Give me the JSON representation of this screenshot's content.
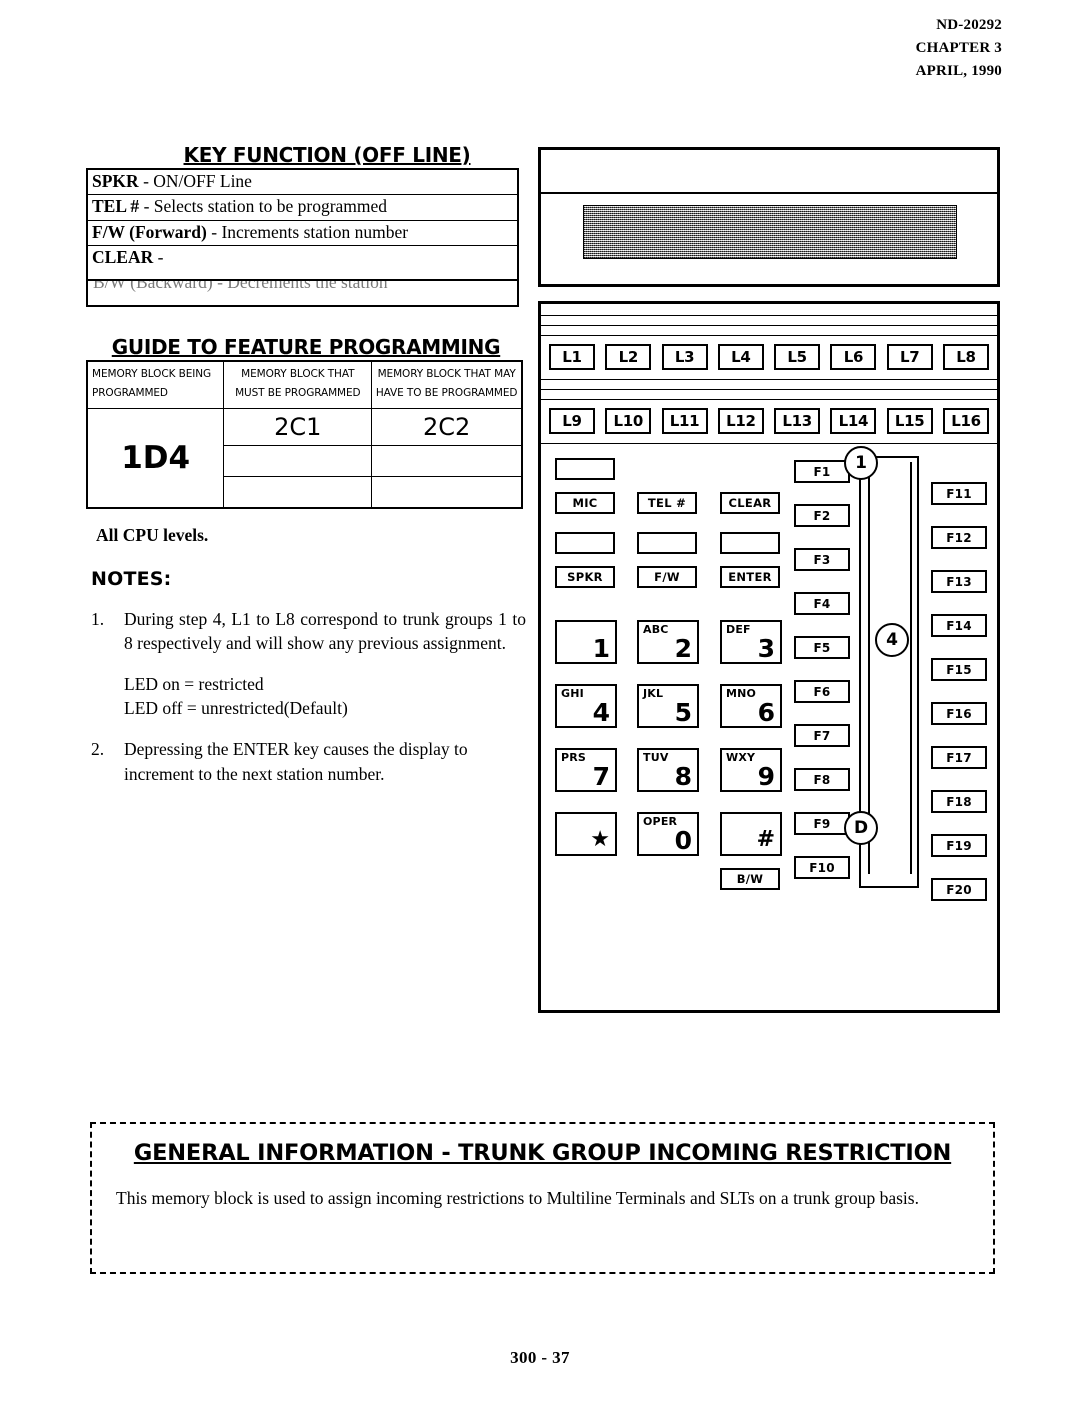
{
  "header": {
    "doc_number": "ND-20292",
    "chapter": "CHAPTER 3",
    "date": "APRIL, 1990"
  },
  "key_function": {
    "title": "KEY FUNCTION (OFF LINE)",
    "rows": [
      {
        "key": "SPKR",
        "desc": "- ON/OFF Line"
      },
      {
        "key": "TEL #",
        "desc": "- Selects station to be programmed"
      },
      {
        "key": "F/W (Forward)",
        "desc": "- Increments station number"
      },
      {
        "key": "CLEAR",
        "desc": "-"
      }
    ],
    "faded_row": "B/W (Backward) -  Decrements the station"
  },
  "guide": {
    "title": "GUIDE TO FEATURE PROGRAMMING",
    "headers": [
      {
        "line1": "MEMORY BLOCK BEING",
        "line2": "PROGRAMMED"
      },
      {
        "line1": "MEMORY BLOCK THAT",
        "line2": "MUST BE PROGRAMMED"
      },
      {
        "line1": "MEMORY BLOCK THAT MAY",
        "line2": "HAVE TO BE PROGRAMMED"
      }
    ],
    "block_programmed": "1D4",
    "must_be_programmed": "2C1",
    "may_have_to_be_programmed": "2C2",
    "empty_cell": ""
  },
  "cpu_note": "All CPU levels.",
  "notes": {
    "title": "NOTES:",
    "items": [
      {
        "num": "1.",
        "text": "During step 4, L1 to L8 correspond to trunk groups 1 to 8 respectively and will show any previous assignment.",
        "sub1": "LED on = restricted",
        "sub2": "LED off = unrestricted(Default)"
      },
      {
        "num": "2.",
        "text": "Depressing the ENTER key causes the display to increment to the next station number."
      }
    ]
  },
  "phone": {
    "line_keys_row1": [
      "L1",
      "L2",
      "L3",
      "L4",
      "L5",
      "L6",
      "L7",
      "L8"
    ],
    "line_keys_row2": [
      "L9",
      "L10",
      "L11",
      "L12",
      "L13",
      "L14",
      "L15",
      "L16"
    ],
    "function_buttons": [
      "MIC",
      "TEL #",
      "CLEAR",
      "SPKR",
      "F/W",
      "ENTER"
    ],
    "mic_label": "MIC",
    "tel_label": "TEL #",
    "clear_label": "CLEAR",
    "spkr_label": "SPKR",
    "fw_label": "F/W",
    "enter_label": "ENTER",
    "bw_label": "B/W",
    "dial_keys": [
      {
        "letters": "",
        "digit": "1"
      },
      {
        "letters": "ABC",
        "digit": "2"
      },
      {
        "letters": "DEF",
        "digit": "3"
      },
      {
        "letters": "GHI",
        "digit": "4"
      },
      {
        "letters": "JKL",
        "digit": "5"
      },
      {
        "letters": "MNO",
        "digit": "6"
      },
      {
        "letters": "PRS",
        "digit": "7"
      },
      {
        "letters": "TUV",
        "digit": "8"
      },
      {
        "letters": "WXY",
        "digit": "9"
      },
      {
        "letters": "",
        "digit": "★"
      },
      {
        "letters": "OPER",
        "digit": "0"
      },
      {
        "letters": "",
        "digit": "#"
      }
    ],
    "fkeys_left": [
      "F1",
      "F2",
      "F3",
      "F4",
      "F5",
      "F6",
      "F7",
      "F8",
      "F9",
      "F10"
    ],
    "fkeys_right": [
      "F11",
      "F12",
      "F13",
      "F14",
      "F15",
      "F16",
      "F17",
      "F18",
      "F19",
      "F20"
    ],
    "callouts": [
      "1",
      "4",
      "D"
    ]
  },
  "general_info": {
    "title": "GENERAL INFORMATION  -  TRUNK GROUP INCOMING RESTRICTION",
    "body": "This memory block is used to assign incoming restrictions to Multiline Terminals and SLTs on a trunk group basis."
  },
  "footer": {
    "page": "300 - 37"
  }
}
